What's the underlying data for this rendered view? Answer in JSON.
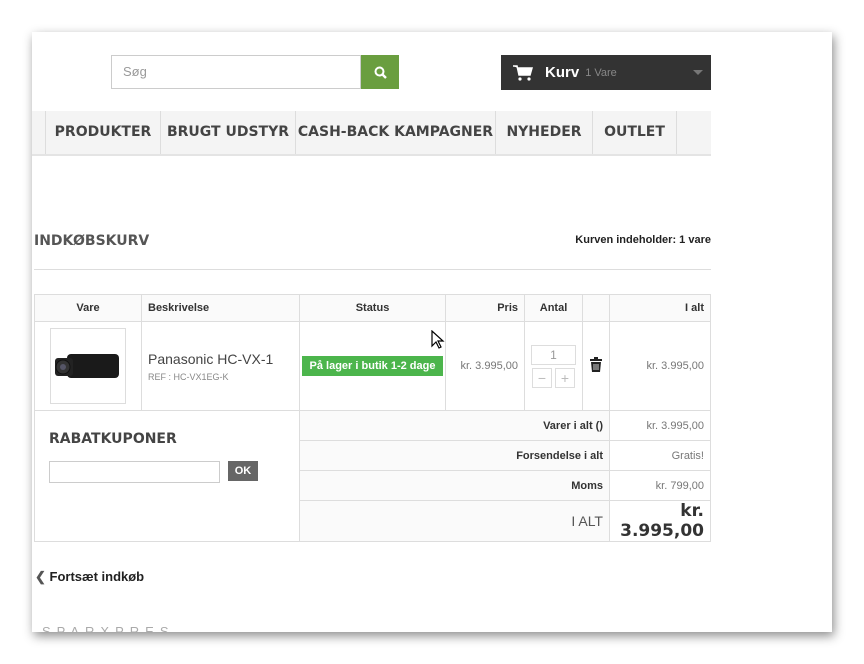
{
  "search": {
    "placeholder": "Søg",
    "icon": "search-icon"
  },
  "cart": {
    "label": "Kurv",
    "count": "1 Vare"
  },
  "nav": [
    "PRODUKTER",
    "BRUGT UDSTYR",
    "CASH-BACK KAMPAGNER",
    "NYHEDER",
    "OUTLET"
  ],
  "page_title": "INDKØBSKURV",
  "cart_count_text": "Kurven indeholder: 1 vare",
  "table": {
    "headers": [
      "Vare",
      "Beskrivelse",
      "Status",
      "Pris",
      "Antal",
      "",
      "I alt"
    ],
    "item": {
      "name": "Panasonic HC-VX-1",
      "ref": "REF : HC-VX1EG-K",
      "status": "På lager i butik 1-2 dage",
      "price": "kr. 3.995,00",
      "qty": "1",
      "total": "kr. 3.995,00"
    }
  },
  "coupon": {
    "title": "RABATKUPONER",
    "button": "OK"
  },
  "summary": [
    {
      "label": "Varer i alt ()",
      "value": "kr. 3.995,00"
    },
    {
      "label": "Forsendelse i alt",
      "value": "Gratis!"
    },
    {
      "label": "Moms",
      "value": "kr. 799,00"
    },
    {
      "label": "I ALT",
      "value": "kr. 3.995,00"
    }
  ],
  "continue": "Fortsæt indkøb",
  "footer_heading": "SPARXPRES",
  "colors": {
    "green": "#6a9e3f",
    "badge": "#4cb54c",
    "cart_bg": "#333333"
  }
}
